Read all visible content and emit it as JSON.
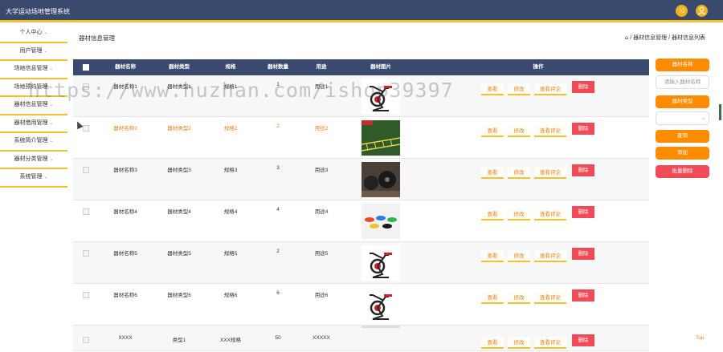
{
  "app": {
    "title": "大学运动场地管理系统"
  },
  "header_icons": [
    "shuffle-icon",
    "user-icon"
  ],
  "sidebar": {
    "items": [
      {
        "label": "个人中心"
      },
      {
        "label": "用户管理"
      },
      {
        "label": "场地信息管理"
      },
      {
        "label": "场地预约管理"
      },
      {
        "label": "器材信息管理"
      },
      {
        "label": "器材借用管理"
      },
      {
        "label": "系统简介管理"
      },
      {
        "label": "器材分类管理"
      },
      {
        "label": "系统管理"
      }
    ]
  },
  "page": {
    "heading": "器材信息管理",
    "breadcrumb": [
      "器材信息管理",
      "器材信息列表"
    ]
  },
  "table": {
    "headers": [
      "器材名称",
      "器材类型",
      "规格",
      "器材数量",
      "用途",
      "器材图片",
      "操作"
    ],
    "action_labels": {
      "view": "查看",
      "edit": "修改",
      "review": "查看评论",
      "delete": "删除"
    },
    "rows": [
      {
        "name": "器材名称1",
        "type": "器材类型1",
        "spec": "规格1",
        "qty": "1",
        "use": "用途1",
        "image": "exercise-bike"
      },
      {
        "name": "器材名称2",
        "type": "器材类型2",
        "spec": "规格2",
        "qty": "2",
        "use": "用途2",
        "image": "agility-ladder"
      },
      {
        "name": "器材名称3",
        "type": "器材类型3",
        "spec": "规格3",
        "qty": "3",
        "use": "用途3",
        "image": "gym-weights"
      },
      {
        "name": "器材名称4",
        "type": "器材类型4",
        "spec": "规格4",
        "qty": "4",
        "use": "用途4",
        "image": "colored-discs"
      },
      {
        "name": "器材名称5",
        "type": "器材类型5",
        "spec": "规格5",
        "qty": "2",
        "use": "用途5",
        "image": "exercise-bike"
      },
      {
        "name": "器材名称6",
        "type": "器材类型6",
        "spec": "规格6",
        "qty": "6",
        "use": "用途6",
        "image": "exercise-bike"
      },
      {
        "name": "XXXX",
        "type": "类型1",
        "spec": "XXX规格",
        "qty": "50",
        "use": "XXXXX",
        "image": "none"
      }
    ]
  },
  "search_panel": {
    "name_label": "器材名称",
    "name_placeholder": "请输入器材名称",
    "type_label": "器材类型",
    "query_button": "查询",
    "add_button": "添加",
    "batch_delete_button": "批量删除"
  },
  "footer": {
    "top_link": "Top"
  },
  "watermark": "https://www.huzhan.com/ishop39397",
  "colors": {
    "header_bg": "#3a4a6e",
    "accent_yellow": "#f6c12a",
    "orange": "#ff8c00",
    "delete_red": "#f14b57"
  }
}
